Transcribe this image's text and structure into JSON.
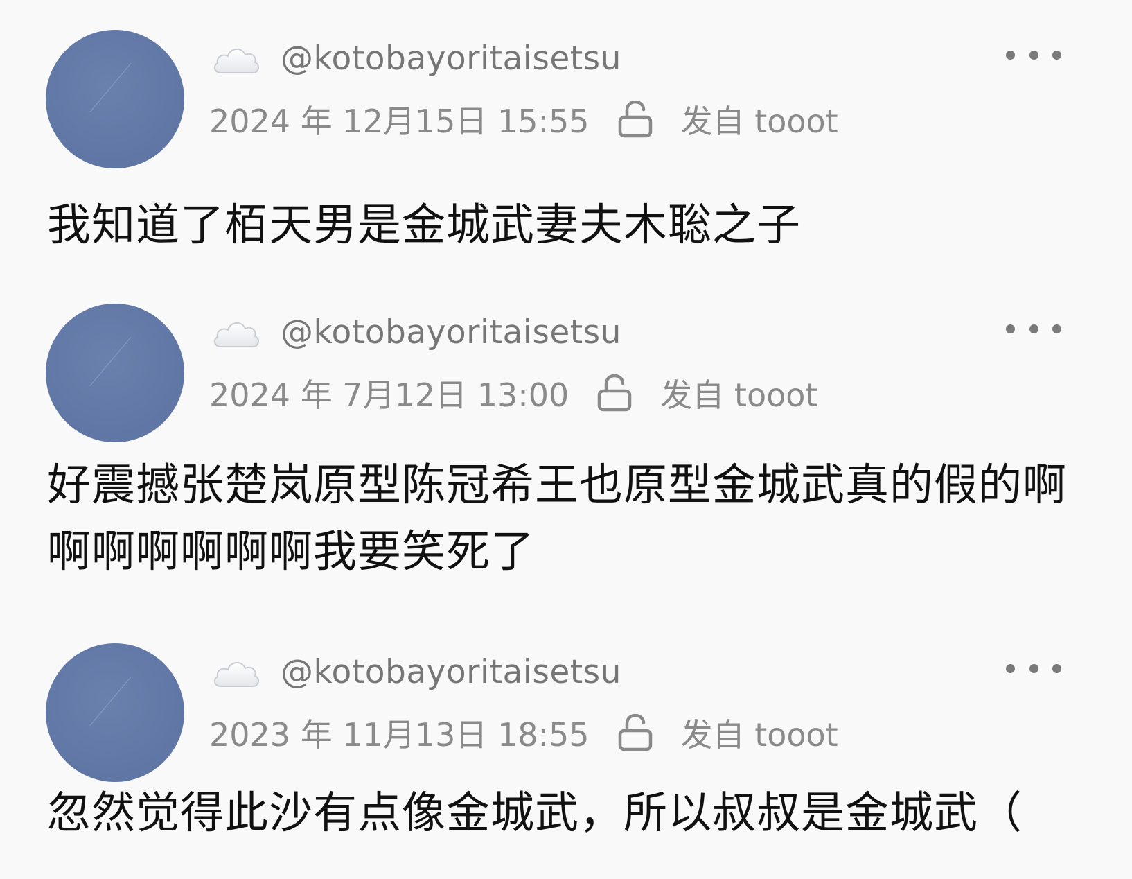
{
  "posts": [
    {
      "handle": "@kotobayoritaisetsu",
      "datetime": "2024 年 12月15日 15:55",
      "via": "发自 tooot",
      "content": "我知道了栢天男是金城武妻夫木聡之子"
    },
    {
      "handle": "@kotobayoritaisetsu",
      "datetime": "2024 年 7月12日 13:00",
      "via": "发自 tooot",
      "content": "好震撼张楚岚原型陈冠希王也原型金城武真的假的啊啊啊啊啊啊啊我要笑死了"
    },
    {
      "handle": "@kotobayoritaisetsu",
      "datetime": "2023 年 11月13日 18:55",
      "via": "发自 tooot",
      "content": "忽然觉得此沙有点像金城武，所以叔叔是金城武（"
    }
  ],
  "icons": {
    "avatar": "avatar",
    "cloud": "cloud-icon",
    "lock": "unlock-icon",
    "more": "more-dots-icon"
  },
  "colors": {
    "background": "#f9f9f9",
    "avatar": "#6279a7",
    "meta_text": "#8a8a8a",
    "body_text": "#111111"
  }
}
